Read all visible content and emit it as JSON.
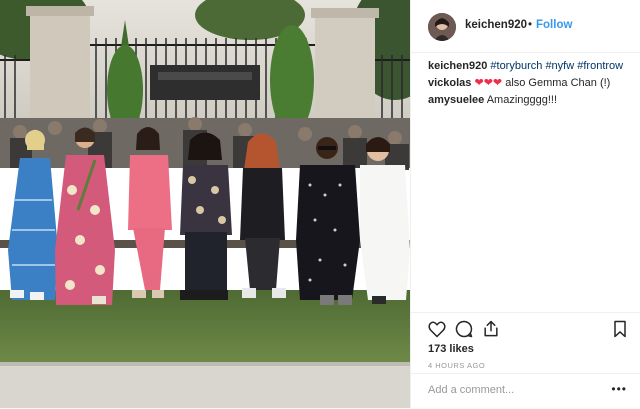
{
  "post": {
    "username": "keichen920",
    "separator": "•",
    "follow_label": "Follow",
    "comments": [
      {
        "user": "keichen920",
        "text_parts": [
          "#toryburch",
          "#nyfw",
          "#frontrow"
        ]
      },
      {
        "user": "vickolas",
        "hearts": "❤❤❤",
        "text": " also Gemma Chan (!)"
      },
      {
        "user": "amysuelee",
        "text": " Amazingggg!!!"
      }
    ],
    "likes": "173 likes",
    "time": "4 HOURS AGO",
    "comment_placeholder": "Add a comment...",
    "more_label": "•••"
  },
  "colors": {
    "accent": "#3897f0",
    "heart": "#ed2f4b",
    "hashtag": "#003569",
    "muted": "#999999"
  },
  "icons": [
    "heart-icon",
    "comment-icon",
    "share-icon",
    "bookmark-icon",
    "more-options-icon"
  ]
}
